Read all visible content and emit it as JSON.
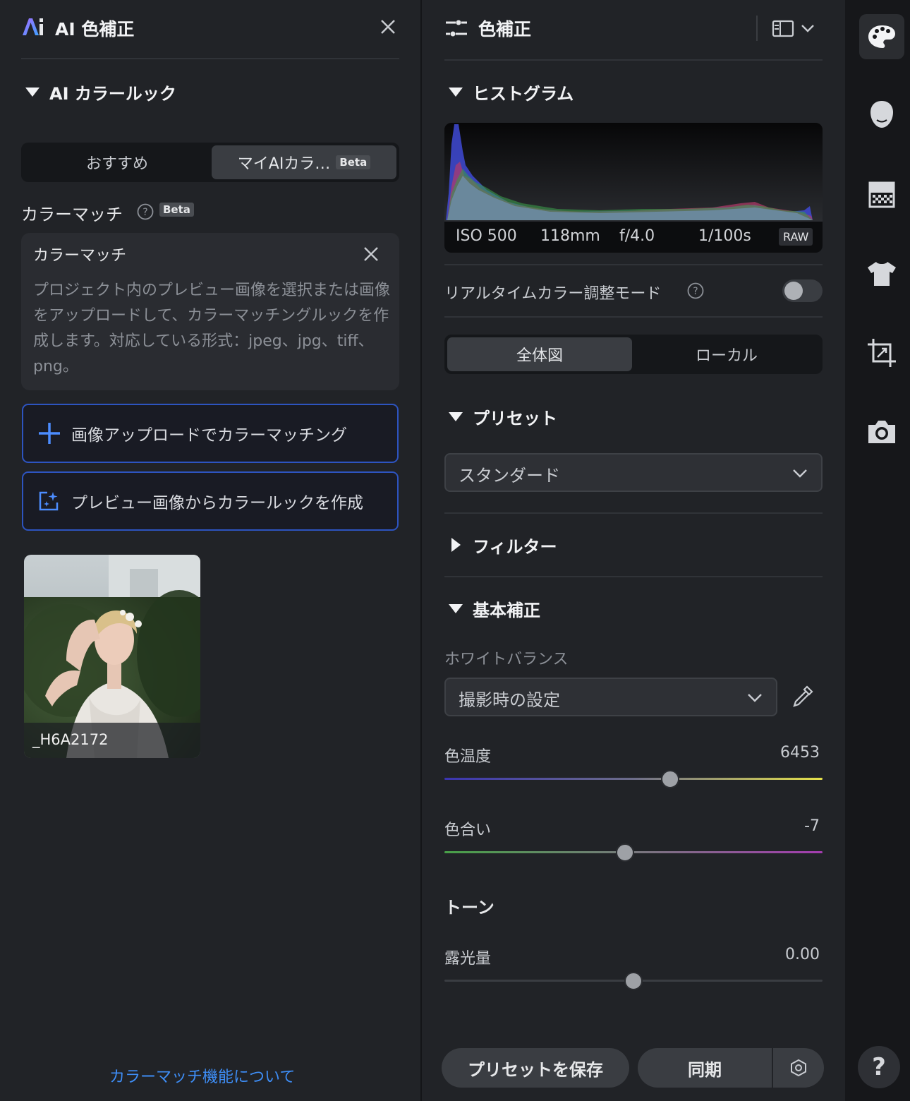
{
  "left_panel": {
    "title": "AI 色補正",
    "section_title": "AI カラールック",
    "tabs": [
      {
        "label": "おすすめ"
      },
      {
        "label": "マイAIカラ…",
        "badge": "Beta"
      }
    ],
    "color_match": {
      "label": "カラーマッチ",
      "badge": "Beta",
      "card_title": "カラーマッチ",
      "card_body": "プロジェクト内のプレビュー画像を選択または画像をアップロードして、カラーマッチングルックを作成します。対応している形式：jpeg、jpg、tiff、png。"
    },
    "actions": {
      "upload": "画像アップロードでカラーマッチング",
      "from_preview": "プレビュー画像からカラールックを作成"
    },
    "thumbnail_caption": "_H6A2172",
    "footer_link": "カラーマッチ機能について"
  },
  "mid_panel": {
    "title": "色補正",
    "histogram": {
      "title": "ヒストグラム",
      "iso": "ISO 500",
      "focal": "118mm",
      "aperture": "f/4.0",
      "shutter": "1/100s",
      "format": "RAW"
    },
    "realtime_label": "リアルタイムカラー調整モード",
    "view_tabs": [
      {
        "label": "全体図"
      },
      {
        "label": "ローカル"
      }
    ],
    "preset": {
      "title": "プリセット",
      "value": "スタンダード"
    },
    "filter_title": "フィルター",
    "basic": {
      "title": "基本補正",
      "wb_label": "ホワイトバランス",
      "wb_value": "撮影時の設定",
      "temp_label": "色温度",
      "temp_value": "6453",
      "temp_pos": 0.597,
      "tint_label": "色合い",
      "tint_value": "-7",
      "tint_pos": 0.477,
      "tone_title": "トーン",
      "exposure_label": "露光量",
      "exposure_value": "0.00",
      "exposure_pos": 0.5
    },
    "footer": {
      "save_preset": "プリセットを保存",
      "sync": "同期"
    }
  },
  "rail": {
    "icons": [
      "palette-icon",
      "face-icon",
      "gradient-icon",
      "shirt-icon",
      "crop-icon",
      "camera-icon"
    ],
    "help": "?"
  },
  "colors": {
    "accent_blue": "#3e8ef7",
    "button_border": "#2d54c0"
  }
}
